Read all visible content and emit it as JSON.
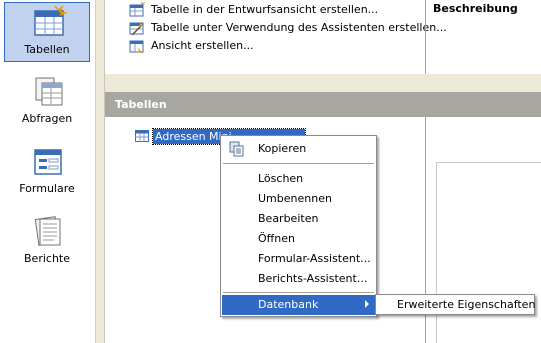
{
  "nav": {
    "items": [
      {
        "label": "Tabellen",
        "icon": "tables-icon",
        "active": true
      },
      {
        "label": "Abfragen",
        "icon": "queries-icon"
      },
      {
        "label": "Formulare",
        "icon": "forms-icon"
      },
      {
        "label": "Berichte",
        "icon": "reports-icon"
      }
    ]
  },
  "tasks": {
    "items": [
      {
        "label": "Tabelle in der Entwurfsansicht erstellen...",
        "icon": "table-design-icon"
      },
      {
        "label": "Tabelle unter Verwendung des Assistenten erstellen...",
        "icon": "table-wizard-icon"
      },
      {
        "label": "Ansicht erstellen...",
        "icon": "view-create-icon"
      }
    ],
    "description_title": "Beschreibung"
  },
  "section": {
    "title": "Tabellen"
  },
  "list": {
    "items": [
      {
        "label": "Adressen Mini... ",
        "icon": "table-icon",
        "selected": true
      }
    ]
  },
  "context_menu": {
    "items": [
      {
        "label": "Kopieren",
        "icon": "copy-icon"
      },
      {
        "label": "Löschen"
      },
      {
        "label": "Umbenennen"
      },
      {
        "label": "Bearbeiten"
      },
      {
        "label": "Öffnen"
      },
      {
        "label": "Formular-Assistent..."
      },
      {
        "label": "Berichts-Assistent..."
      },
      {
        "label": "Datenbank",
        "highlighted": true,
        "has_submenu": true
      }
    ],
    "submenu": {
      "items": [
        {
          "label": "Erweiterte Eigenschaften"
        }
      ]
    }
  },
  "colors": {
    "selection": "#316ac5",
    "nav_active_bg": "#c1d2ee",
    "section_header_bg": "#a7a6a0",
    "panel_bg": "#ece9d8"
  }
}
